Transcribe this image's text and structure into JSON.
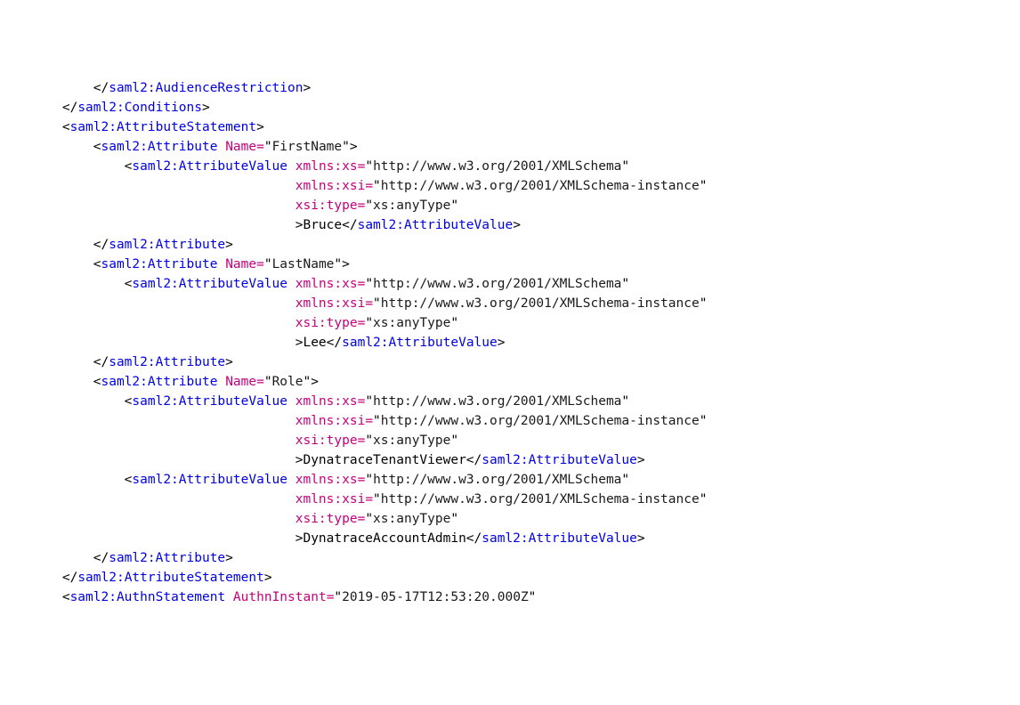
{
  "xml": {
    "schemaUrl": "http://www.w3.org/2001/XMLSchema",
    "schemaInstanceUrl": "http://www.w3.org/2001/XMLSchema-instance",
    "anyType": "xs:anyType",
    "tags": {
      "audienceRestrictionClose": "saml2:AudienceRestriction",
      "conditionsClose": "saml2:Conditions",
      "attributeStatement": "saml2:AttributeStatement",
      "attribute": "saml2:Attribute",
      "attributeValue": "saml2:AttributeValue",
      "authnStatement": "saml2:AuthnStatement"
    },
    "attrs": {
      "name": "Name",
      "xmlnsXs": "xmlns:xs",
      "xmlnsXsi": "xmlns:xsi",
      "xsiType": "xsi:type",
      "authnInstant": "AuthnInstant"
    },
    "values": {
      "firstNameLabel": "FirstName",
      "lastNameLabel": "LastName",
      "roleLabel": "Role",
      "firstName": "Bruce",
      "lastName": "Lee",
      "role1": "DynatraceTenantViewer",
      "role2": "DynatraceAccountAdmin",
      "authnInstantVal": "2019-05-17T12:53:20.000Z"
    }
  }
}
